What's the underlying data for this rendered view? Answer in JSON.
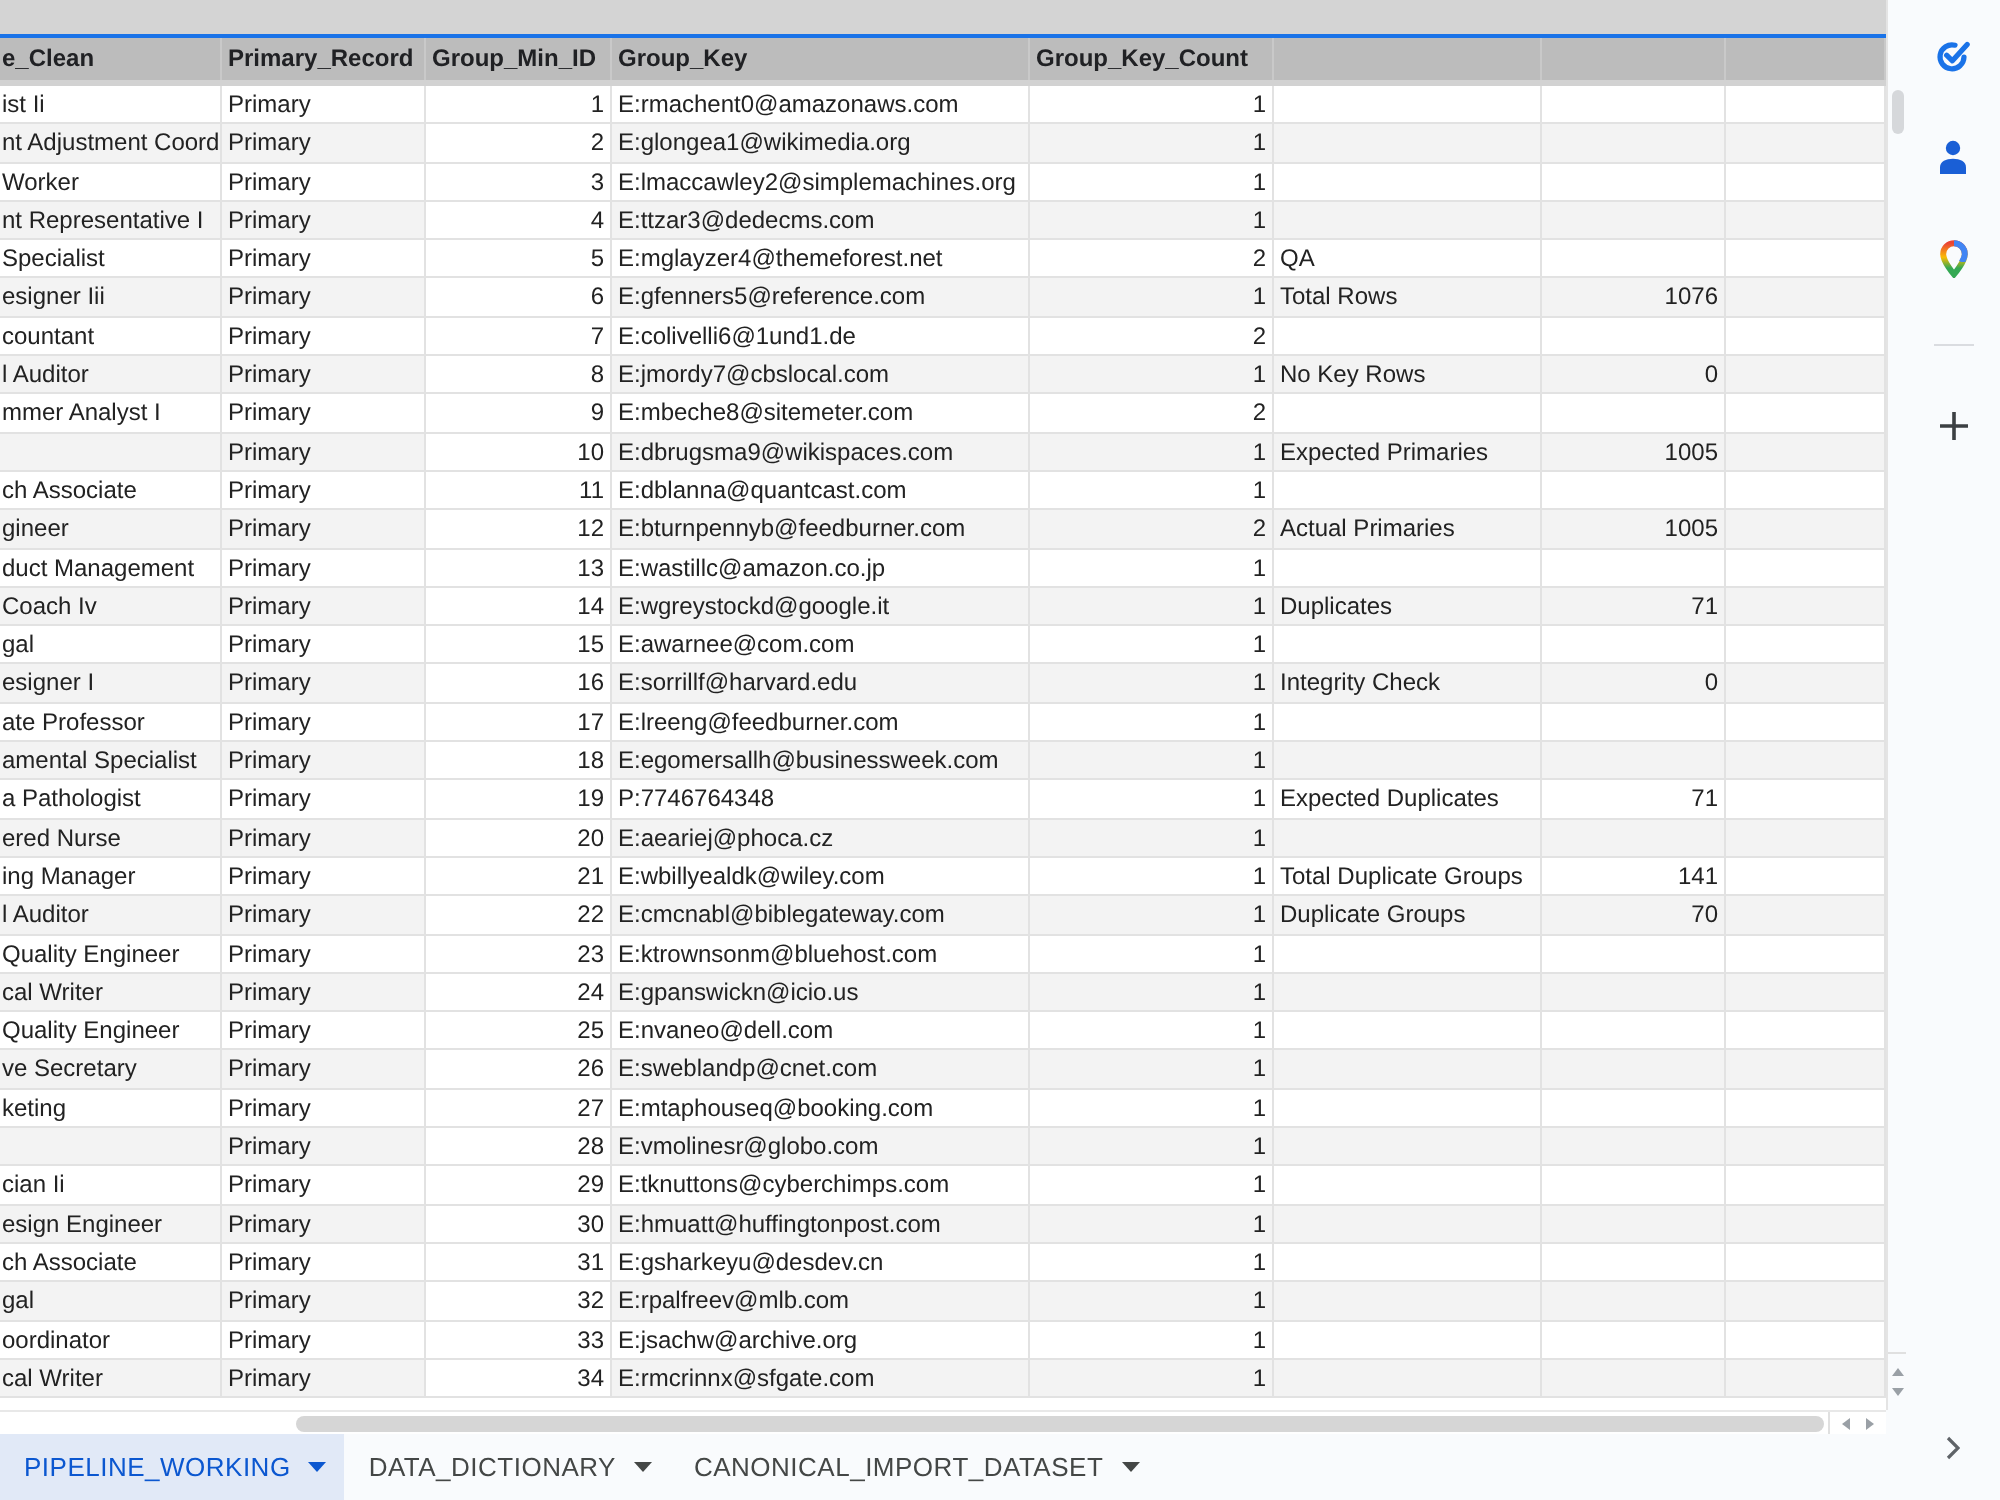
{
  "sheet": {
    "columns": [
      {
        "label": "e_Clean"
      },
      {
        "label": "Primary_Record"
      },
      {
        "label": "Group_Min_ID"
      },
      {
        "label": "Group_Key"
      },
      {
        "label": "Group_Key_Count"
      }
    ],
    "rows": [
      {
        "e_clean": "ist Ii",
        "primary_record": "Primary",
        "group_min_id": "1",
        "group_key": "E:rmachent0@amazonaws.com",
        "group_key_count": "1"
      },
      {
        "e_clean": "nt Adjustment Coord",
        "primary_record": "Primary",
        "group_min_id": "2",
        "group_key": "E:glongea1@wikimedia.org",
        "group_key_count": "1"
      },
      {
        "e_clean": "Worker",
        "primary_record": "Primary",
        "group_min_id": "3",
        "group_key": "E:lmaccawley2@simplemachines.org",
        "group_key_count": "1"
      },
      {
        "e_clean": "nt Representative I",
        "primary_record": "Primary",
        "group_min_id": "4",
        "group_key": "E:ttzar3@dedecms.com",
        "group_key_count": "1"
      },
      {
        "e_clean": "Specialist",
        "primary_record": "Primary",
        "group_min_id": "5",
        "group_key": "E:mglayzer4@themeforest.net",
        "group_key_count": "2",
        "column_6": "QA"
      },
      {
        "e_clean": "esigner Iii",
        "primary_record": "Primary",
        "group_min_id": "6",
        "group_key": "E:gfenners5@reference.com",
        "group_key_count": "1",
        "column_6": "Total Rows",
        "column_7": "1076"
      },
      {
        "e_clean": "countant",
        "primary_record": "Primary",
        "group_min_id": "7",
        "group_key": "E:colivelli6@1und1.de",
        "group_key_count": "2"
      },
      {
        "e_clean": "l Auditor",
        "primary_record": "Primary",
        "group_min_id": "8",
        "group_key": "E:jmordy7@cbslocal.com",
        "group_key_count": "1",
        "column_6": "No Key Rows",
        "column_7": "0"
      },
      {
        "e_clean": "mmer Analyst I",
        "primary_record": "Primary",
        "group_min_id": "9",
        "group_key": "E:mbeche8@sitemeter.com",
        "group_key_count": "2"
      },
      {
        "primary_record": "Primary",
        "group_min_id": "10",
        "group_key": "E:dbrugsma9@wikispaces.com",
        "group_key_count": "1",
        "column_6": "Expected Primaries",
        "column_7": "1005"
      },
      {
        "e_clean": "ch Associate",
        "primary_record": "Primary",
        "group_min_id": "11",
        "group_key": "E:dblanna@quantcast.com",
        "group_key_count": "1"
      },
      {
        "e_clean": "gineer",
        "primary_record": "Primary",
        "group_min_id": "12",
        "group_key": "E:bturnpennyb@feedburner.com",
        "group_key_count": "2",
        "column_6": "Actual Primaries",
        "column_7": "1005"
      },
      {
        "e_clean": "duct Management",
        "primary_record": "Primary",
        "group_min_id": "13",
        "group_key": "E:wastillc@amazon.co.jp",
        "group_key_count": "1"
      },
      {
        "e_clean": "Coach Iv",
        "primary_record": "Primary",
        "group_min_id": "14",
        "group_key": "E:wgreystockd@google.it",
        "group_key_count": "1",
        "column_6": "Duplicates",
        "column_7": "71"
      },
      {
        "e_clean": "gal",
        "primary_record": "Primary",
        "group_min_id": "15",
        "group_key": "E:awarnee@com.com",
        "group_key_count": "1"
      },
      {
        "e_clean": "esigner I",
        "primary_record": "Primary",
        "group_min_id": "16",
        "group_key": "E:sorrillf@harvard.edu",
        "group_key_count": "1",
        "column_6": "Integrity Check",
        "column_7": "0"
      },
      {
        "e_clean": "ate Professor",
        "primary_record": "Primary",
        "group_min_id": "17",
        "group_key": "E:lreeng@feedburner.com",
        "group_key_count": "1"
      },
      {
        "e_clean": "amental Specialist",
        "primary_record": "Primary",
        "group_min_id": "18",
        "group_key": "E:egomersallh@businessweek.com",
        "group_key_count": "1"
      },
      {
        "e_clean": "a Pathologist",
        "primary_record": "Primary",
        "group_min_id": "19",
        "group_key": "P:7746764348",
        "group_key_count": "1",
        "column_6": "Expected Duplicates",
        "column_7": "71"
      },
      {
        "e_clean": "ered Nurse",
        "primary_record": "Primary",
        "group_min_id": "20",
        "group_key": "E:aeariej@phoca.cz",
        "group_key_count": "1"
      },
      {
        "e_clean": "ing Manager",
        "primary_record": "Primary",
        "group_min_id": "21",
        "group_key": "E:wbillyealdk@wiley.com",
        "group_key_count": "1",
        "column_6": "Total Duplicate Groups",
        "column_7": "141"
      },
      {
        "e_clean": "l Auditor",
        "primary_record": "Primary",
        "group_min_id": "22",
        "group_key": "E:cmcnabl@biblegateway.com",
        "group_key_count": "1",
        "column_6": "Duplicate Groups",
        "column_7": "70"
      },
      {
        "e_clean": "Quality Engineer",
        "primary_record": "Primary",
        "group_min_id": "23",
        "group_key": "E:ktrownsonm@bluehost.com",
        "group_key_count": "1"
      },
      {
        "e_clean": "cal Writer",
        "primary_record": "Primary",
        "group_min_id": "24",
        "group_key": "E:gpanswickn@icio.us",
        "group_key_count": "1"
      },
      {
        "e_clean": "Quality Engineer",
        "primary_record": "Primary",
        "group_min_id": "25",
        "group_key": "E:nvaneo@dell.com",
        "group_key_count": "1"
      },
      {
        "e_clean": "ve Secretary",
        "primary_record": "Primary",
        "group_min_id": "26",
        "group_key": "E:sweblandp@cnet.com",
        "group_key_count": "1"
      },
      {
        "e_clean": "keting",
        "primary_record": "Primary",
        "group_min_id": "27",
        "group_key": "E:mtaphouseq@booking.com",
        "group_key_count": "1"
      },
      {
        "primary_record": "Primary",
        "group_min_id": "28",
        "group_key": "E:vmolinesr@globo.com",
        "group_key_count": "1"
      },
      {
        "e_clean": "cian Ii",
        "primary_record": "Primary",
        "group_min_id": "29",
        "group_key": "E:tknuttons@cyberchimps.com",
        "group_key_count": "1"
      },
      {
        "e_clean": "esign Engineer",
        "primary_record": "Primary",
        "group_min_id": "30",
        "group_key": "E:hmuatt@huffingtonpost.com",
        "group_key_count": "1"
      },
      {
        "e_clean": "ch Associate",
        "primary_record": "Primary",
        "group_min_id": "31",
        "group_key": "E:gsharkeyu@desdev.cn",
        "group_key_count": "1"
      },
      {
        "e_clean": "gal",
        "primary_record": "Primary",
        "group_min_id": "32",
        "group_key": "E:rpalfreev@mlb.com",
        "group_key_count": "1"
      },
      {
        "e_clean": "oordinator",
        "primary_record": "Primary",
        "group_min_id": "33",
        "group_key": "E:jsachw@archive.org",
        "group_key_count": "1"
      },
      {
        "e_clean": "cal Writer",
        "primary_record": "Primary",
        "group_min_id": "34",
        "group_key": "E:rmcrinnx@sfgate.com",
        "group_key_count": "1"
      }
    ]
  },
  "sheet_tabs": [
    {
      "label": "PIPELINE_WORKING",
      "selected": true
    },
    {
      "label": "DATA_DICTIONARY",
      "selected": false
    },
    {
      "label": "CANONICAL_IMPORT_DATASET",
      "selected": false
    }
  ]
}
